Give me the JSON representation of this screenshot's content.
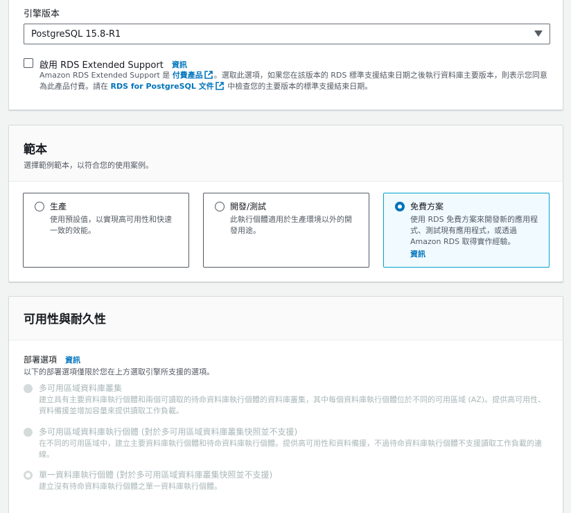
{
  "engine": {
    "version_label": "引擎版本",
    "selected_version": "PostgreSQL 15.8-R1",
    "extended_support": {
      "label": "啟用 RDS Extended Support",
      "info": "資訊",
      "desc_prefix": "Amazon RDS Extended Support 是 ",
      "desc_link1": "付費產品",
      "desc_mid": "。選取此選項，如果您在該版本的 RDS 標準支援結束日期之後執行資料庫主要版本，則表示您同意為此產品付費。請在 ",
      "desc_link2": "RDS for PostgreSQL 文件",
      "desc_suffix": " 中檢查您的主要版本的標準支援結束日期。"
    }
  },
  "templates": {
    "title": "範本",
    "description": "選擇範例範本，以符合您的使用案例。",
    "items": [
      {
        "title": "生產",
        "description": "使用預設值，以實現高可用性和快速一致的效能。"
      },
      {
        "title": "開發/測試",
        "description": "此執行個體適用於生產環境以外的開發用途。"
      },
      {
        "title": "免費方案",
        "description": "使用 RDS 免費方案來開發新的應用程式、測試現有應用程式，或透過 Amazon RDS 取得實作經驗。",
        "info": "資訊"
      }
    ],
    "selected": "免費方案"
  },
  "availability": {
    "title": "可用性與耐久性",
    "deploy_label": "部署選項",
    "deploy_info": "資訊",
    "deploy_sub": "以下的部署選項僅限於您在上方選取引擎所支援的選項。",
    "options": [
      {
        "title": "多可用區域資料庫叢集",
        "description": "建立具有主要資料庫執行個體和兩個可讀取的待命資料庫執行個體的資料庫叢集，其中每個資料庫執行個體位於不同的可用區域 (AZ)。提供高可用性、資料備援並增加容量來提供讀取工作負載。"
      },
      {
        "title": "多可用區域資料庫執行個體 (對於多可用區域資料庫叢集快照並不支援)",
        "description": "在不同的可用區域中，建立主要資料庫執行個體和待命資料庫執行個體。提供高可用性和資料備援，不過待命資料庫執行個體不支援讀取工作負載的連線。"
      },
      {
        "title": "單一資料庫執行個體 (對於多可用區域資料庫叢集快照並不支援)",
        "description": "建立沒有待命資料庫執行個體之單一資料庫執行個體。"
      }
    ]
  },
  "colors": {
    "link": "#0073bb",
    "selected_border": "#00a1c9",
    "selected_bg": "#f1faff",
    "disabled_text": "#aab7b8"
  }
}
